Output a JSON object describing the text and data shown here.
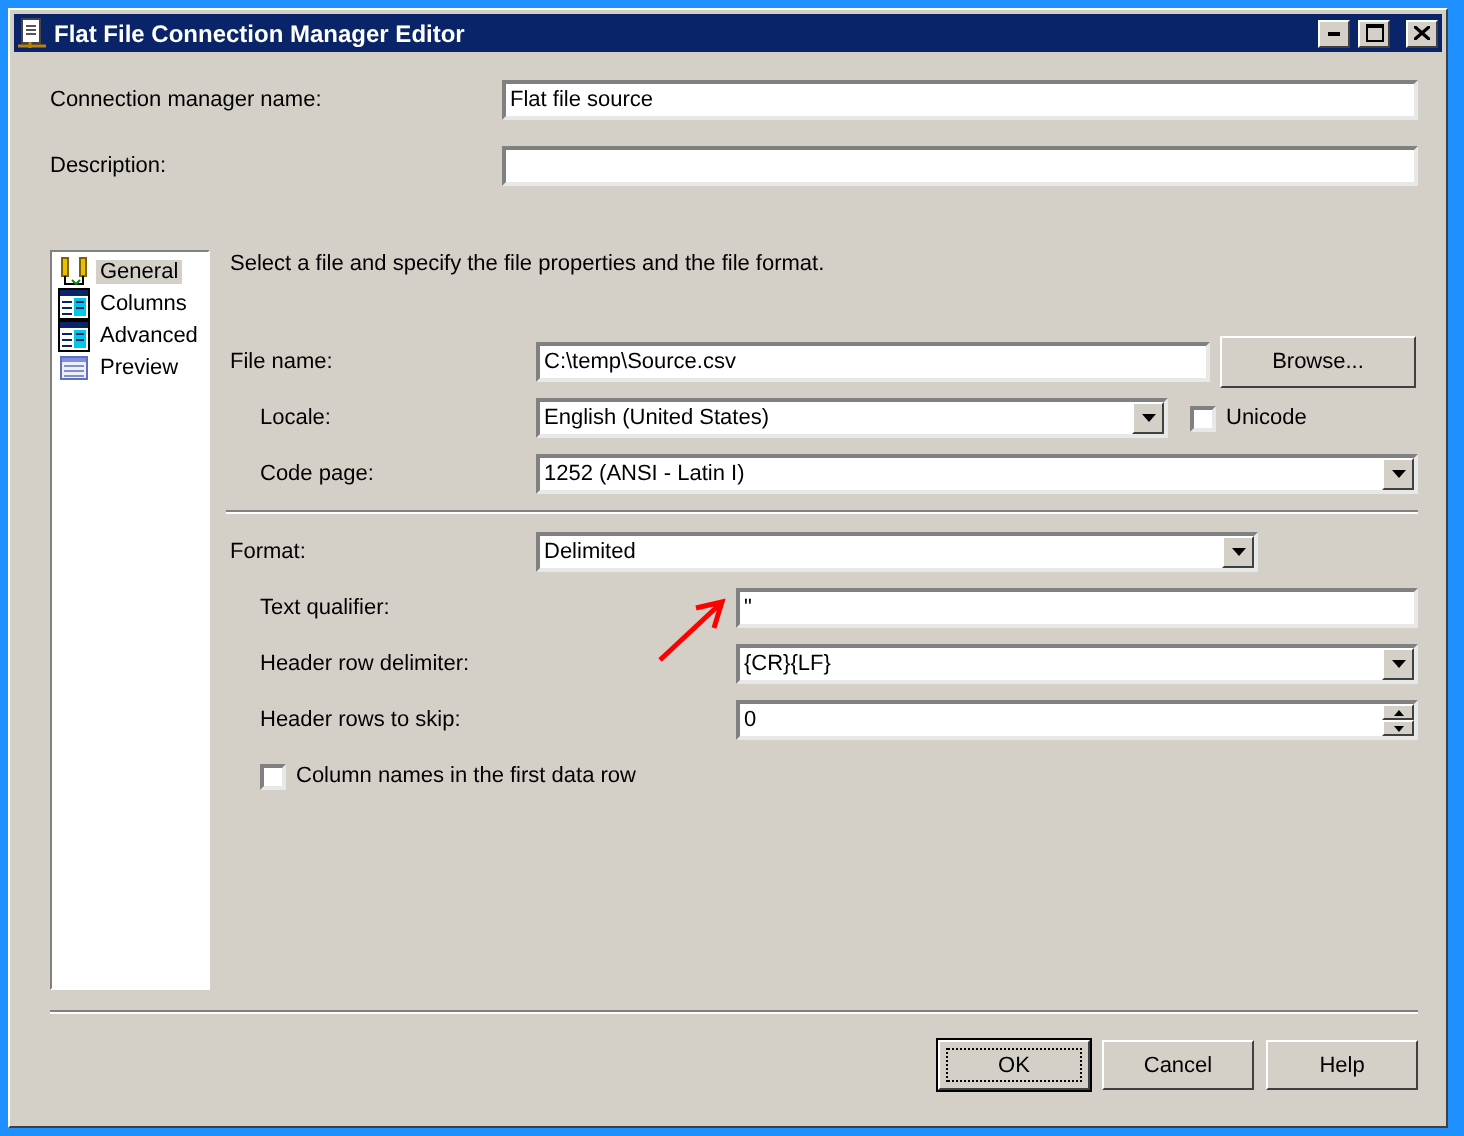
{
  "window": {
    "title": "Flat File Connection Manager Editor"
  },
  "header_fields": [
    {
      "label": "Connection manager name:",
      "value": "Flat file source"
    },
    {
      "label": "Description:"
    }
  ],
  "sidebar": {
    "items": [
      {
        "label": "General",
        "kind": "connection",
        "selected": true
      },
      {
        "label": "Columns",
        "kind": "table",
        "selected": false
      },
      {
        "label": "Advanced",
        "kind": "table",
        "selected": false
      },
      {
        "label": "Preview",
        "kind": "preview",
        "selected": false
      }
    ]
  },
  "intro": "Select a file and specify the file properties and the file format.",
  "file_rows": [
    {
      "kind": "file",
      "label": "File name:",
      "value": "C:\\temp\\Source.csv",
      "button": "Browse..."
    },
    {
      "kind": "combo_check",
      "label": "Locale:",
      "value": "English (United States)",
      "check_label": "Unicode",
      "checked": false
    },
    {
      "kind": "combo",
      "label": "Code page:",
      "value": "1252  (ANSI - Latin I)"
    }
  ],
  "format": {
    "label": "Format:",
    "value": "Delimited"
  },
  "format_rows": [
    {
      "kind": "text",
      "label": "Text qualifier:",
      "value": "\"",
      "annotated": true
    },
    {
      "kind": "combo",
      "label": "Header row delimiter:",
      "value": "{CR}{LF}",
      "annotated": false
    },
    {
      "kind": "spin",
      "label": "Header rows to skip:",
      "value": "0",
      "annotated": false
    }
  ],
  "column_names_checkbox": {
    "label": "Column names in the first data row",
    "checked": false
  },
  "buttons": [
    {
      "label": "OK",
      "default": true
    },
    {
      "label": "Cancel",
      "default": false
    },
    {
      "label": "Help",
      "default": false
    }
  ]
}
